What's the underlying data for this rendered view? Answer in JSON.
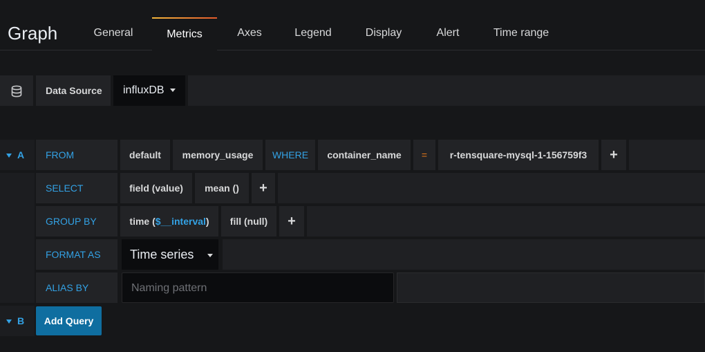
{
  "header": {
    "title": "Graph",
    "tabs": [
      "General",
      "Metrics",
      "Axes",
      "Legend",
      "Display",
      "Alert",
      "Time range"
    ],
    "active_tab": "Metrics"
  },
  "datasource": {
    "label": "Data Source",
    "value": "influxDB",
    "icon": "database-icon"
  },
  "query_a": {
    "letter": "A",
    "from": {
      "label": "FROM",
      "policy": "default",
      "measurement": "memory_usage",
      "where_label": "WHERE",
      "tag_key": "container_name",
      "operator": "=",
      "tag_value": "r-tensquare-mysql-1-156759f3",
      "add": "+"
    },
    "select": {
      "label": "SELECT",
      "field": "field (value)",
      "func": "mean ()",
      "add": "+"
    },
    "group_by": {
      "label": "GROUP BY",
      "time_prefix": "time (",
      "time_var": "$__interval",
      "time_suffix": ")",
      "fill": "fill (null)",
      "add": "+"
    },
    "format_as": {
      "label": "FORMAT AS",
      "value": "Time series"
    },
    "alias_by": {
      "label": "ALIAS BY",
      "placeholder": "Naming pattern"
    }
  },
  "query_b": {
    "letter": "B",
    "add_query": "Add Query"
  },
  "colors": {
    "background": "#161719",
    "label_blue": "#33a2e5",
    "button_blue": "#0f6ea0",
    "operator_orange": "#eb7b18",
    "tab_gradient_start": "#f5b73b",
    "tab_gradient_end": "#e55a2b"
  }
}
